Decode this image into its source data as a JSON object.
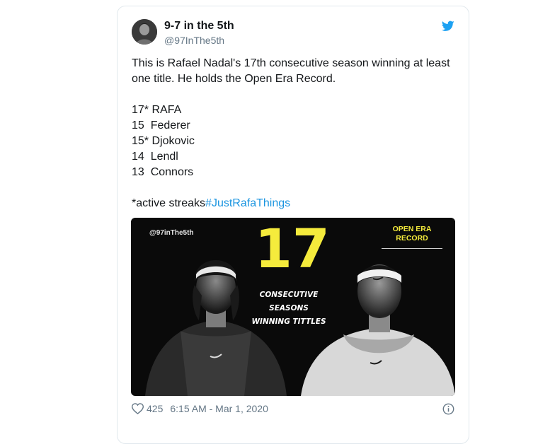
{
  "tweet": {
    "display_name": "9-7 in the 5th",
    "handle": "@97InThe5th",
    "text_paragraph": "This is Rafael Nadal's 17th consecutive season winning at least one title. He holds the Open Era Record.",
    "list": [
      "17* RAFA",
      "15  Federer",
      "15* Djokovic",
      "14  Lendl",
      "13  Connors"
    ],
    "footnote": "*active streaks",
    "hashtag": "#JustRafaThings",
    "media": {
      "watermark": "@97inThe5th",
      "big_number": "17",
      "caption_lines": [
        "CONSECUTIVE",
        "SEASONS",
        "WINNING TITTLES"
      ],
      "badge_lines": [
        "OPEN ERA",
        "RECORD"
      ]
    },
    "likes": "425",
    "timestamp": "6:15 AM - Mar 1, 2020"
  },
  "icons": {
    "bird": "twitter-bird-icon",
    "heart": "heart-icon",
    "info": "info-icon"
  },
  "colors": {
    "hashtag": "#1b95e0",
    "bird": "#1da1f2",
    "accent_yellow": "#f5eb3c"
  }
}
